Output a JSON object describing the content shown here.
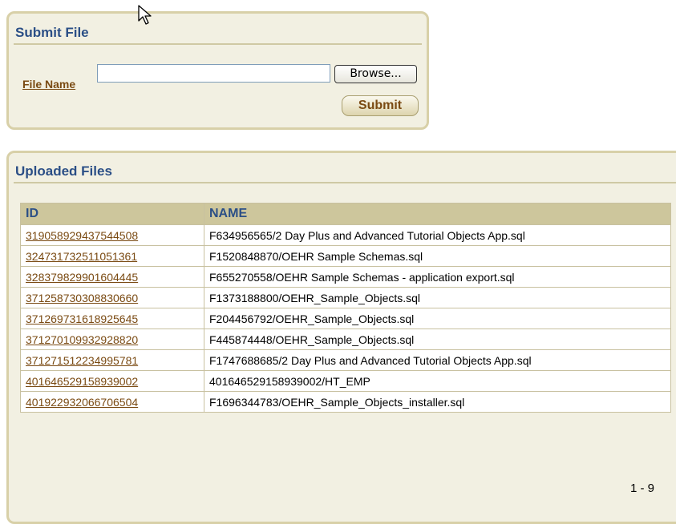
{
  "submit_region": {
    "title": "Submit File",
    "file_label": "File Name",
    "file_value": "",
    "browse_label": "Browse...",
    "submit_label": "Submit"
  },
  "uploaded_region": {
    "title": "Uploaded Files",
    "columns": [
      "ID",
      "NAME"
    ],
    "rows": [
      {
        "id": "319058929437544508",
        "name": "F634956565/2 Day Plus and Advanced Tutorial Objects App.sql"
      },
      {
        "id": "324731732511051361",
        "name": "F1520848870/OEHR Sample Schemas.sql"
      },
      {
        "id": "328379829901604445",
        "name": "F655270558/OEHR Sample Schemas - application export.sql"
      },
      {
        "id": "371258730308830660",
        "name": "F1373188800/OEHR_Sample_Objects.sql"
      },
      {
        "id": "371269731618925645",
        "name": "F204456792/OEHR_Sample_Objects.sql"
      },
      {
        "id": "371270109932928820",
        "name": "F445874448/OEHR_Sample_Objects.sql"
      },
      {
        "id": "371271512234995781",
        "name": "F1747688685/2 Day Plus and Advanced Tutorial Objects App.sql"
      },
      {
        "id": "401646529158939002",
        "name": "401646529158939002/HT_EMP"
      },
      {
        "id": "401922932066706504",
        "name": "F1696344783/OEHR_Sample_Objects_installer.sql"
      }
    ],
    "pagination": "1 - 9"
  },
  "icons": {
    "cursor": "arrow-cursor-icon"
  },
  "colors": {
    "region_background": "#f2f0e2",
    "region_border": "#d8d0a8",
    "title_text": "#2b4f86",
    "link_text": "#7a4a12",
    "header_background": "#cdc69c"
  }
}
